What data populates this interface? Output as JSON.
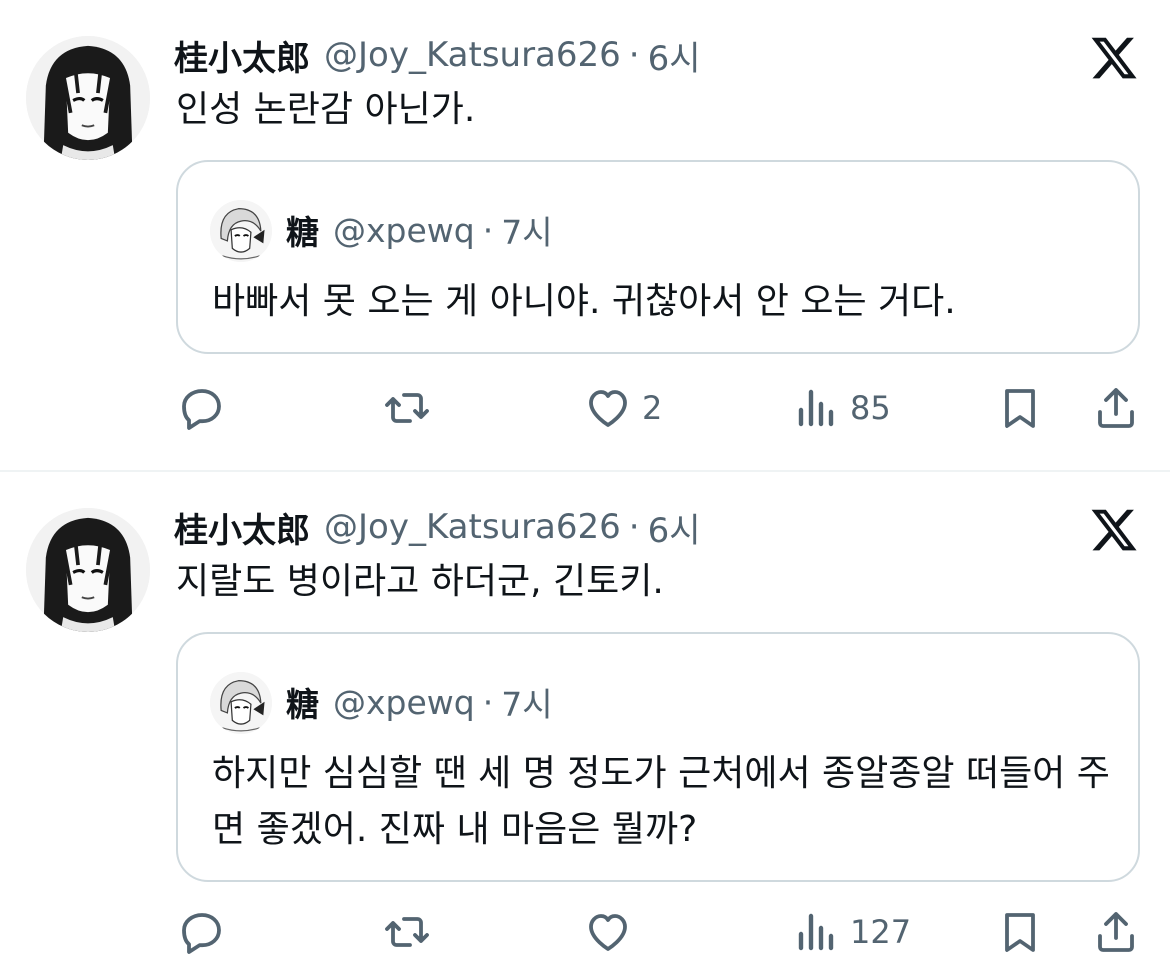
{
  "tweets": [
    {
      "author": {
        "name": "桂小太郎",
        "handle": "@Joy_Katsura626",
        "time": "6시"
      },
      "text": "인성 논란감 아닌가.",
      "quote": {
        "author": {
          "name": "糖",
          "handle": "@xpewq",
          "time": "7시"
        },
        "text": "바빠서 못 오는 게 아니야. 귀찮아서 안 오는 거다."
      },
      "stats": {
        "likes": "2",
        "views": "85"
      }
    },
    {
      "author": {
        "name": "桂小太郎",
        "handle": "@Joy_Katsura626",
        "time": "6시"
      },
      "text": "지랄도 병이라고 하더군, 긴토키.",
      "quote": {
        "author": {
          "name": "糖",
          "handle": "@xpewq",
          "time": "7시"
        },
        "text": "하지만 심심할 땐 세 명 정도가 근처에서 종알종알 떠들어 주면 좋겠어. 진짜 내 마음은 뭘까?"
      },
      "stats": {
        "likes": "",
        "views": "127"
      }
    }
  ],
  "separator": "·",
  "icons": {
    "logo": "x-logo-icon",
    "reply": "reply-icon",
    "repost": "repost-icon",
    "like": "heart-icon",
    "views": "views-icon",
    "bookmark": "bookmark-icon",
    "share": "share-icon"
  },
  "colors": {
    "text": "#0f1419",
    "secondary": "#536471",
    "border": "#cfd9de"
  }
}
